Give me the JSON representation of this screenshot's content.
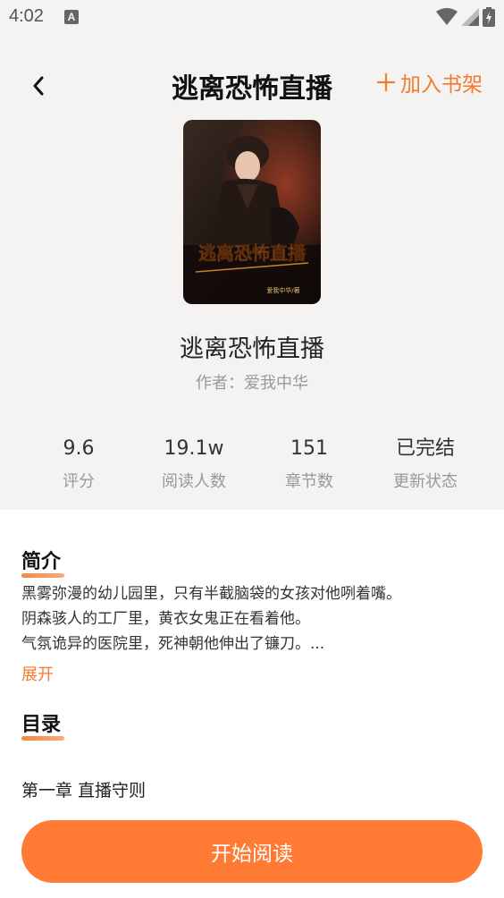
{
  "status_bar": {
    "time": "4:02",
    "notification_glyph": "A"
  },
  "header": {
    "title": "逃离恐怖直播",
    "add_shelf_label": "加入书架"
  },
  "book": {
    "cover_title": "逃离恐怖直播",
    "cover_subtitle": "爱我中华/著",
    "name": "逃离恐怖直播",
    "author": "作者：爱我中华"
  },
  "stats": [
    {
      "value": "9.6",
      "label": "评分"
    },
    {
      "value": "19.1w",
      "label": "阅读人数"
    },
    {
      "value": "151",
      "label": "章节数"
    },
    {
      "value": "已完结",
      "label": "更新状态"
    }
  ],
  "intro": {
    "title": "简介",
    "lines": [
      "黑雾弥漫的幼儿园里，只有半截脑袋的女孩对他咧着嘴。",
      "阴森骇人的工厂里，黄衣女鬼正在看着他。",
      "气氛诡异的医院里，死神朝他伸出了镰刀。..."
    ],
    "expand_label": "展开"
  },
  "catalog": {
    "title": "目录",
    "first_chapter": "第一章 直播守则"
  },
  "actions": {
    "start_reading": "开始阅读"
  },
  "colors": {
    "accent": "#ff7a32",
    "background_top": "#f4f3f2"
  },
  "icons": [
    "back-icon",
    "plus-icon",
    "wifi-icon",
    "signal-icon",
    "battery-icon"
  ]
}
